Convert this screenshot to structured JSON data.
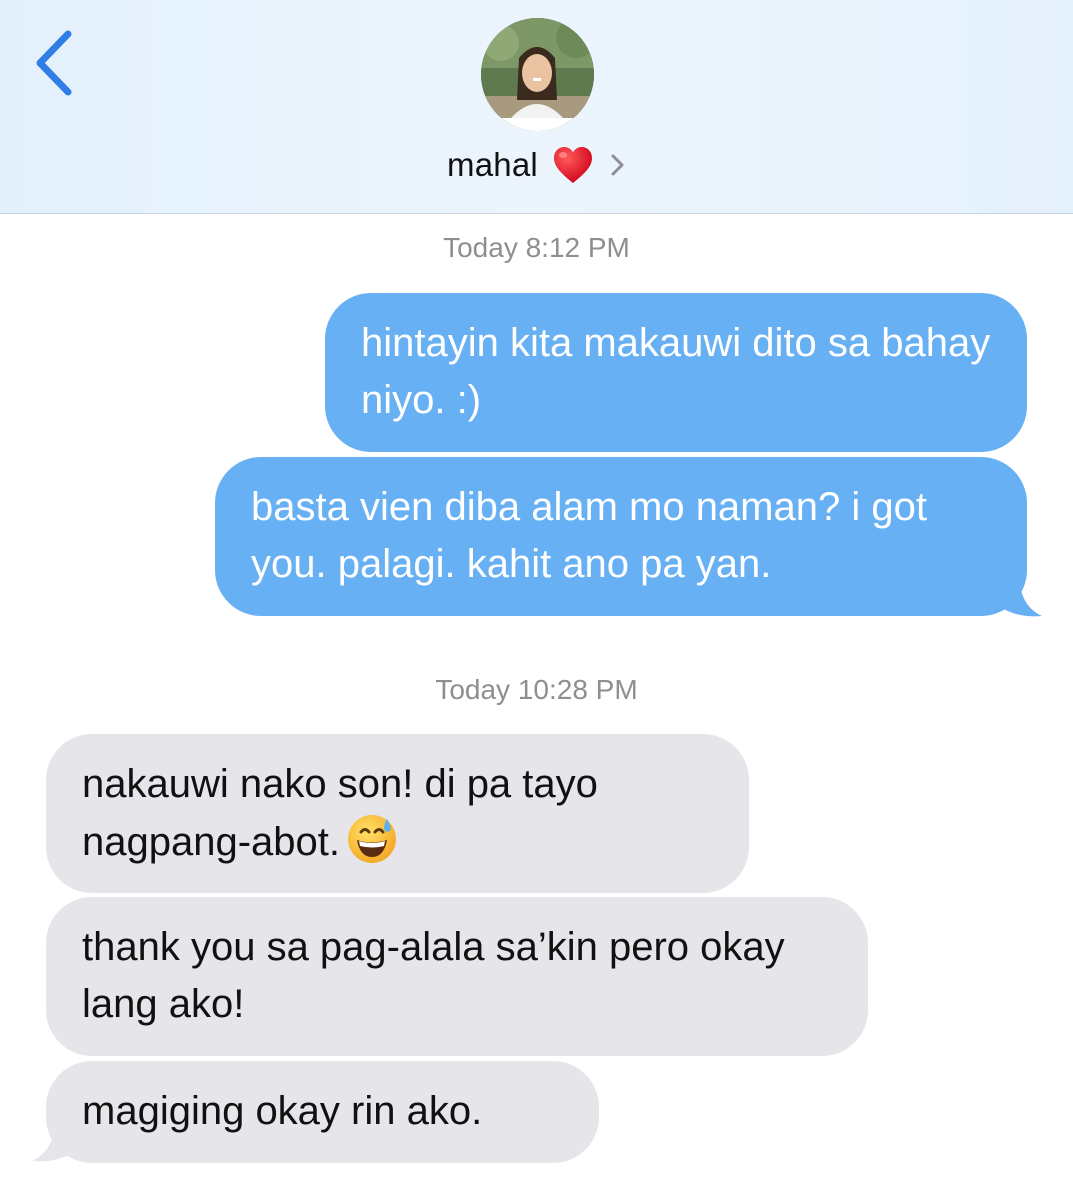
{
  "header": {
    "contact_name": "mahal",
    "heart": "❤️",
    "back_icon": "chevron-left-icon",
    "details_icon": "chevron-right-icon",
    "avatar_icon": "contact-avatar"
  },
  "conversation": {
    "timestamps": [
      "Today 8:12 PM",
      "Today 10:28 PM"
    ],
    "sent": [
      {
        "text": "hintayin kita makauwi dito sa bahay niyo. :)"
      },
      {
        "text": "basta vien diba alam mo naman? i got you. palagi. kahit ano pa yan."
      }
    ],
    "received": [
      {
        "text": "nakauwi nako son! di pa tayo nagpang-abot.",
        "emoji": "😅"
      },
      {
        "text": "thank you sa pag-alala sa’kin pero okay lang ako!"
      },
      {
        "text": "magiging okay rin ako."
      }
    ]
  },
  "colors": {
    "sent_bubble": "#67b0f4",
    "received_bubble": "#e5e5ea",
    "accent": "#2f7ee6",
    "timestamp": "#8e8e93"
  }
}
